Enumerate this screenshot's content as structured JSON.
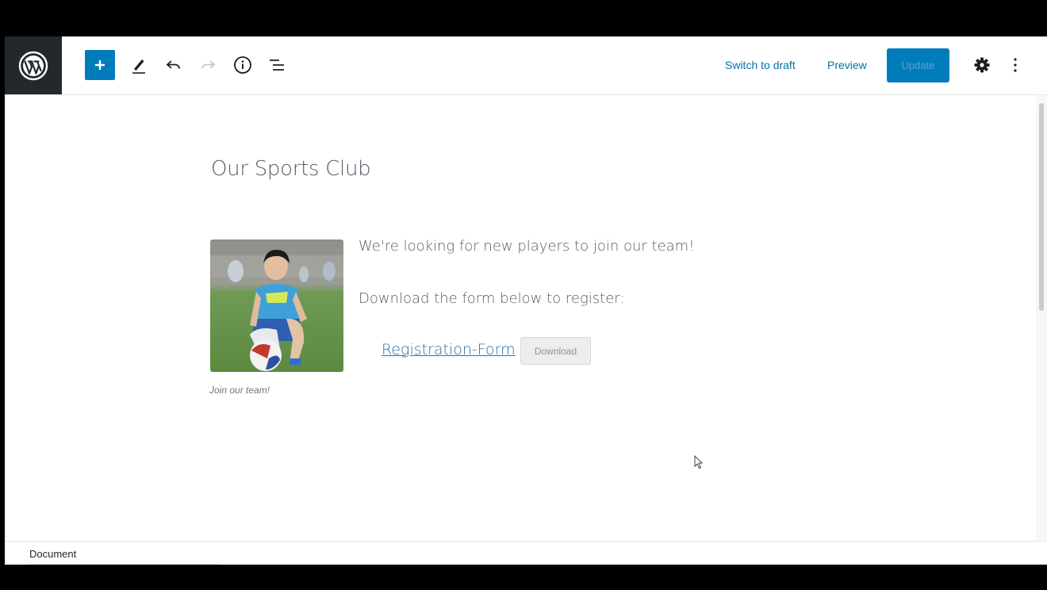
{
  "toolbar": {
    "switch_to_draft": "Switch to draft",
    "preview": "Preview",
    "update": "Update",
    "icons": [
      "wordpress-logo",
      "plus",
      "pencil",
      "undo",
      "redo",
      "info",
      "list-view",
      "gear",
      "more-vertical"
    ]
  },
  "post": {
    "title": "Our Sports Club",
    "image_caption": "Join our team!",
    "paragraph_1": "We're looking for new players to join our team!",
    "paragraph_2": "Download the form below to register:",
    "file_link": "Registration-Form",
    "download_button": "Download"
  },
  "footer": {
    "breadcrumb": "Document"
  },
  "colors": {
    "accent": "#007cba",
    "link": "#0073aa",
    "wp_dark": "#23282d"
  }
}
